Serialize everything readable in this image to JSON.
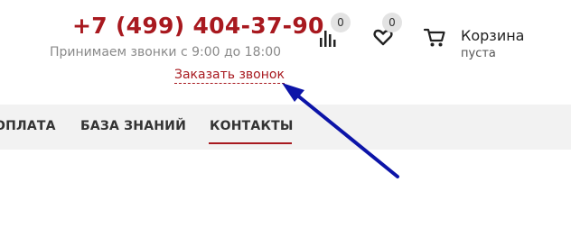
{
  "header": {
    "phone": "+7 (499) 404-37-90",
    "hours": "Принимаем звонки с 9:00 до 18:00",
    "callback_link": "Заказать звонок"
  },
  "icons": {
    "compare": {
      "icon": "bar-chart-icon",
      "count": "0"
    },
    "favorites": {
      "icon": "heart-icon",
      "count": "0"
    },
    "cart": {
      "icon": "cart-icon",
      "label": "Корзина",
      "status": "пуста"
    }
  },
  "nav": {
    "items": [
      {
        "label": "ОПЛАТА"
      },
      {
        "label": "БАЗА ЗНАНИЙ"
      },
      {
        "label": "КОНТАКТЫ",
        "active": true
      }
    ]
  },
  "colors": {
    "brand_red": "#a8191f",
    "annotation_arrow": "#0c14a8",
    "nav_bg": "#f2f2f2"
  }
}
